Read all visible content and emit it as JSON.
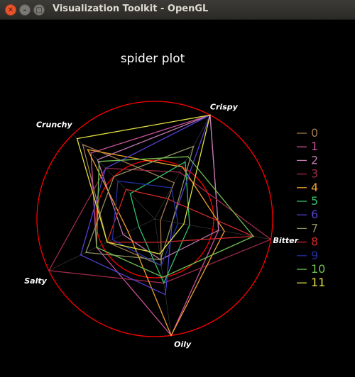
{
  "window": {
    "title": "Visualization Toolkit - OpenGL",
    "close_glyph": "✕",
    "min_glyph": "–",
    "max_glyph": "□"
  },
  "chart_data": {
    "type": "radar",
    "title": "spider plot",
    "axes": [
      "Crispy",
      "Bitter",
      "Oily",
      "Salty",
      "Crunchy"
    ],
    "rmax": 1.0,
    "reference_circles": [
      0.5,
      1.0
    ],
    "series": [
      {
        "name": "0",
        "color": "#a07a50",
        "values": [
          0.35,
          0.05,
          0.4,
          0.45,
          0.88
        ]
      },
      {
        "name": "1",
        "color": "#c8509a",
        "values": [
          1.0,
          0.55,
          1.0,
          0.55,
          0.78
        ]
      },
      {
        "name": "2",
        "color": "#c07ab0",
        "values": [
          1.0,
          0.55,
          0.35,
          0.3,
          0.7
        ]
      },
      {
        "name": "3",
        "color": "#a02a4a",
        "values": [
          0.45,
          1.0,
          0.55,
          1.0,
          0.6
        ]
      },
      {
        "name": "4",
        "color": "#f0a030",
        "values": [
          0.5,
          0.6,
          1.0,
          0.25,
          0.82
        ]
      },
      {
        "name": "5",
        "color": "#30c070",
        "values": [
          0.55,
          0.3,
          0.55,
          0.15,
          0.3
        ]
      },
      {
        "name": "6",
        "color": "#5040d0",
        "values": [
          1.0,
          0.15,
          0.65,
          0.7,
          0.6
        ]
      },
      {
        "name": "7",
        "color": "#909060",
        "values": [
          0.7,
          0.15,
          0.35,
          0.65,
          0.5
        ]
      },
      {
        "name": "8",
        "color": "#d02828",
        "values": [
          0.2,
          0.85,
          0.2,
          0.45,
          0.35
        ]
      },
      {
        "name": "9",
        "color": "#2030a0",
        "values": [
          0.3,
          0.2,
          0.4,
          0.4,
          0.45
        ]
      },
      {
        "name": "10",
        "color": "#70c050",
        "values": [
          0.6,
          0.85,
          0.5,
          0.55,
          0.68
        ]
      },
      {
        "name": "11",
        "color": "#e0e040",
        "values": [
          1.0,
          0.25,
          0.3,
          0.45,
          0.95
        ]
      }
    ]
  }
}
